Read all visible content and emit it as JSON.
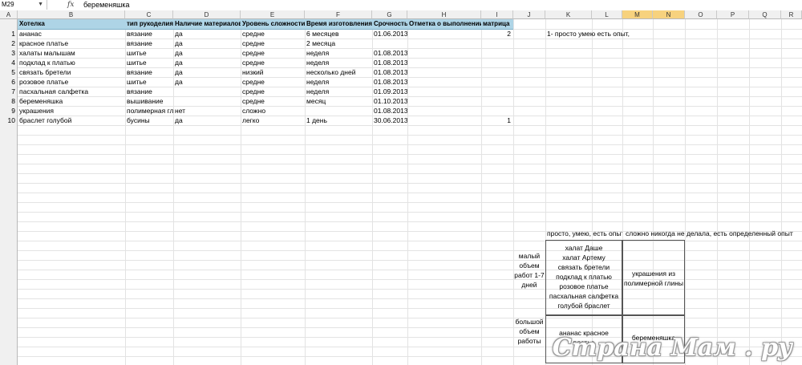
{
  "formula_bar": {
    "name_box": "M29",
    "fx": "fx",
    "value": "беременяшка"
  },
  "columns": [
    "A",
    "B",
    "C",
    "D",
    "E",
    "F",
    "G",
    "H",
    "I",
    "J",
    "K",
    "L",
    "M",
    "N",
    "O",
    "P",
    "Q",
    "R"
  ],
  "headers": {
    "title": "Хотелка",
    "type": "тип рукоделия",
    "materials": "Наличие материалов",
    "difficulty": "Уровень сложности",
    "time": "Время изготовления",
    "urgency": "Срочность",
    "done": "Отметка о выполнении",
    "matrix": "матрица"
  },
  "rows": [
    {
      "n": "1",
      "title": "ананас",
      "type": "вязание",
      "materials": "да",
      "difficulty": "средне",
      "time": "6 месяцев",
      "urgency": "01.06.2013",
      "done": "",
      "matrix": "2"
    },
    {
      "n": "2",
      "title": "красное платье",
      "type": "вязание",
      "materials": "да",
      "difficulty": "средне",
      "time": "2 месяца",
      "urgency": "",
      "done": "",
      "matrix": ""
    },
    {
      "n": "3",
      "title": "халаты малышам",
      "type": "шитье",
      "materials": "да",
      "difficulty": "средне",
      "time": "неделя",
      "urgency": "01.08.2013",
      "done": "",
      "matrix": ""
    },
    {
      "n": "4",
      "title": "подклад к платью",
      "type": "шитье",
      "materials": "да",
      "difficulty": "средне",
      "time": "неделя",
      "urgency": "01.08.2013",
      "done": "",
      "matrix": ""
    },
    {
      "n": "5",
      "title": "связать бретели",
      "type": "вязание",
      "materials": "да",
      "difficulty": "низкий",
      "time": "несколько дней",
      "urgency": "01.08.2013",
      "done": "",
      "matrix": ""
    },
    {
      "n": "6",
      "title": "розовое платье",
      "type": "шитье",
      "materials": "да",
      "difficulty": "средне",
      "time": "неделя",
      "urgency": "01.08.2013",
      "done": "",
      "matrix": ""
    },
    {
      "n": "7",
      "title": "пасхальная салфетка",
      "type": "вязание",
      "materials": "",
      "difficulty": "средне",
      "time": "неделя",
      "urgency": "01.09.2013",
      "done": "",
      "matrix": ""
    },
    {
      "n": "8",
      "title": "беременяшка",
      "type": "вышивание",
      "materials": "",
      "difficulty": "средне",
      "time": "месяц",
      "urgency": "01.10.2013",
      "done": "",
      "matrix": ""
    },
    {
      "n": "9",
      "title": "украшения",
      "type": "полимерная гл",
      "materials": "нет",
      "difficulty": "сложно",
      "time": "",
      "urgency": "01.08.2013",
      "done": "",
      "matrix": ""
    },
    {
      "n": "10",
      "title": "браслет голубой",
      "type": "бусины",
      "materials": "да",
      "difficulty": "легко",
      "time": "1 день",
      "urgency": "30.06.2013",
      "done": "",
      "matrix": "1"
    }
  ],
  "note": "1- просто умею есть опыт,",
  "matrix": {
    "col_easy": "просто, умею, есть опыт",
    "col_hard": "сложно никогда не делала, есть определенный опыт",
    "row_small": [
      "малый",
      "объем",
      "работ 1-7",
      "дней"
    ],
    "row_large": [
      "большой",
      "объем",
      "работы"
    ],
    "q1": [
      "халат Даше",
      "халат Артему",
      "связать бретели",
      "подклад к платью",
      "розовое платье",
      "пасхальная салфетка",
      "голубой браслет"
    ],
    "q2": [
      "украшения из",
      "полимерной глины"
    ],
    "q3": [
      "ананас красное",
      "платье"
    ],
    "q4": [
      "беременяшка"
    ]
  },
  "watermark": "Страна Мам . ру"
}
